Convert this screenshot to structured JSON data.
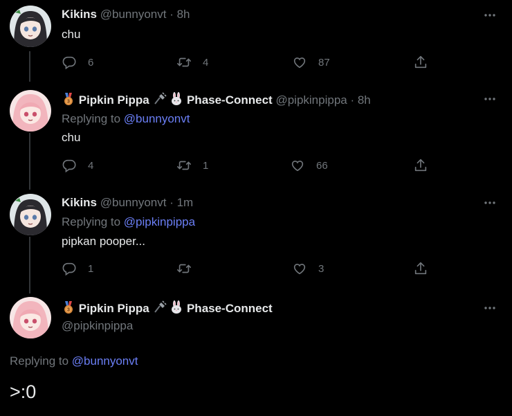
{
  "tweets": [
    {
      "name": "Kikins",
      "handle": "@bunnyonvt",
      "time": "· 8h",
      "replying_prefix": "",
      "replying_to": "",
      "text": "chu",
      "replies": "6",
      "retweets": "4",
      "likes": "87"
    },
    {
      "name": "Pipkin Pippa",
      "affiliation": "Phase-Connect",
      "handle": "@pipkinpippa",
      "time": "· 8h",
      "replying_prefix": "Replying to ",
      "replying_to": "@bunnyonvt",
      "text": "chu",
      "replies": "4",
      "retweets": "1",
      "likes": "66"
    },
    {
      "name": "Kikins",
      "handle": "@bunnyonvt",
      "time": "· 1m",
      "replying_prefix": "Replying to ",
      "replying_to": "@pipkinpippa",
      "text": "pipkan pooper...",
      "replies": "1",
      "retweets": "",
      "likes": "3"
    },
    {
      "name": "Pipkin Pippa",
      "affiliation": "Phase-Connect",
      "handle": "@pipkinpippa",
      "replying_prefix": "Replying to ",
      "replying_to": "@bunnyonvt",
      "text": ">:0"
    }
  ],
  "colors": {
    "background": "#000000",
    "text": "#e7e9ea",
    "muted": "#71767b",
    "link": "#6b7ff6",
    "thread_line": "#333639"
  },
  "icons": [
    "more-icon",
    "reply-icon",
    "retweet-icon",
    "like-icon",
    "share-icon",
    "medal-badge-icon",
    "plug-icon",
    "rabbit-icon"
  ]
}
